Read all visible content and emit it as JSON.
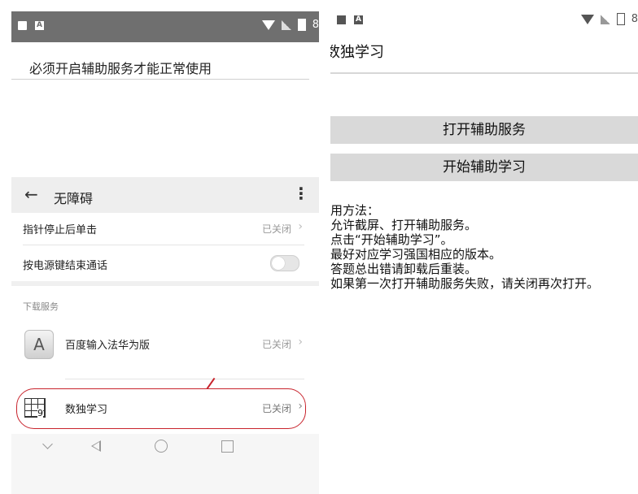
{
  "left_screen": {
    "status_bar": {
      "icons_left": [
        "image-icon",
        "a-icon"
      ],
      "icons_right": [
        "wifi-icon",
        "no-signal-icon",
        "battery-charging-icon"
      ],
      "partial_text": "8"
    },
    "warning": "必须开启辅助服务才能正常使用",
    "app_bar": {
      "title": "无障碍"
    },
    "settings": [
      {
        "label": "指针停止后单击",
        "state": "已关闭"
      },
      {
        "label": "按电源键结束通话",
        "state": "off"
      }
    ],
    "download_section": {
      "title": "下载服务",
      "items": [
        {
          "icon": "keyboard-a-icon",
          "label": "百度输入法华为版",
          "state": "已关闭"
        },
        {
          "icon": "sudoku-grid-icon",
          "label": "数独学习",
          "state": "已关闭"
        }
      ]
    },
    "nav_bar": [
      "chevron-down-icon",
      "back-triangle-icon",
      "home-circle-icon",
      "recents-square-icon"
    ],
    "annotation_color": "#c8232c"
  },
  "right_screen": {
    "status_bar": {
      "icons_left": [
        "image-icon",
        "a-icon"
      ],
      "icons_right": [
        "wifi-icon",
        "no-signal-icon",
        "battery-charging-icon"
      ],
      "partial_text": "8"
    },
    "title": "数独学习",
    "buttons": [
      {
        "label": "打开辅助服务"
      },
      {
        "label": "开始辅助学习"
      }
    ],
    "instructions": [
      "用方法：",
      "允许截屏、打开辅助服务。",
      "点击“开始辅助学习”。",
      "最好对应学习强国相应的版本。",
      "答题总出错请卸载后重装。",
      "如果第一次打开辅助服务失败，请关闭再次打开。"
    ]
  }
}
